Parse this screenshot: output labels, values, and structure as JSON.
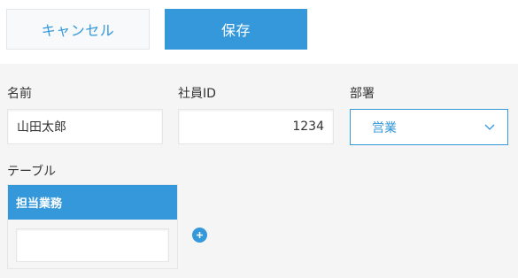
{
  "toolbar": {
    "cancel_label": "キャンセル",
    "save_label": "保存"
  },
  "form": {
    "name": {
      "label": "名前",
      "value": "山田太郎"
    },
    "employee_id": {
      "label": "社員ID",
      "value": "1234"
    },
    "department": {
      "label": "部署",
      "selected": "営業"
    },
    "table": {
      "label": "テーブル",
      "columns": [
        "担当業務"
      ],
      "rows": [
        [
          ""
        ]
      ],
      "add_row_icon": "plus-circle-icon"
    }
  },
  "colors": {
    "accent": "#3498db",
    "form_background": "#f5f5f5",
    "border": "#e3e7e8"
  }
}
